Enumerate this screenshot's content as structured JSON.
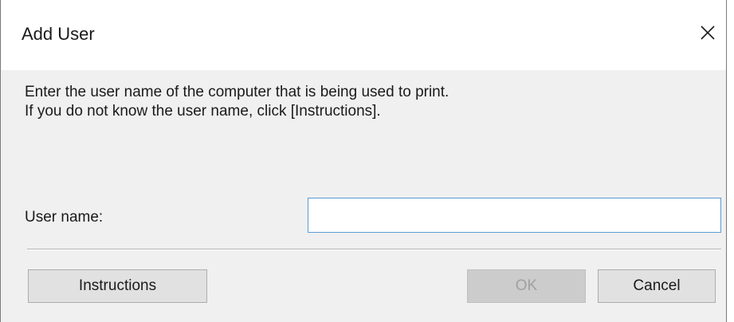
{
  "dialog": {
    "title": "Add User",
    "close_icon": "close-icon",
    "message_lines": [
      "Enter the user name of the computer that is being used to print.",
      "If you do not know the user name, click [Instructions]."
    ],
    "username_label": "User name:",
    "username_value": "",
    "buttons": {
      "instructions": "Instructions",
      "ok": "OK",
      "cancel": "Cancel"
    }
  },
  "colors": {
    "dialog_background": "#f0f0f0",
    "titlebar_background": "#ffffff",
    "input_border_focus": "#5b9bd5",
    "button_face": "#e1e1e1",
    "button_disabled_text": "#a0a0a0"
  }
}
